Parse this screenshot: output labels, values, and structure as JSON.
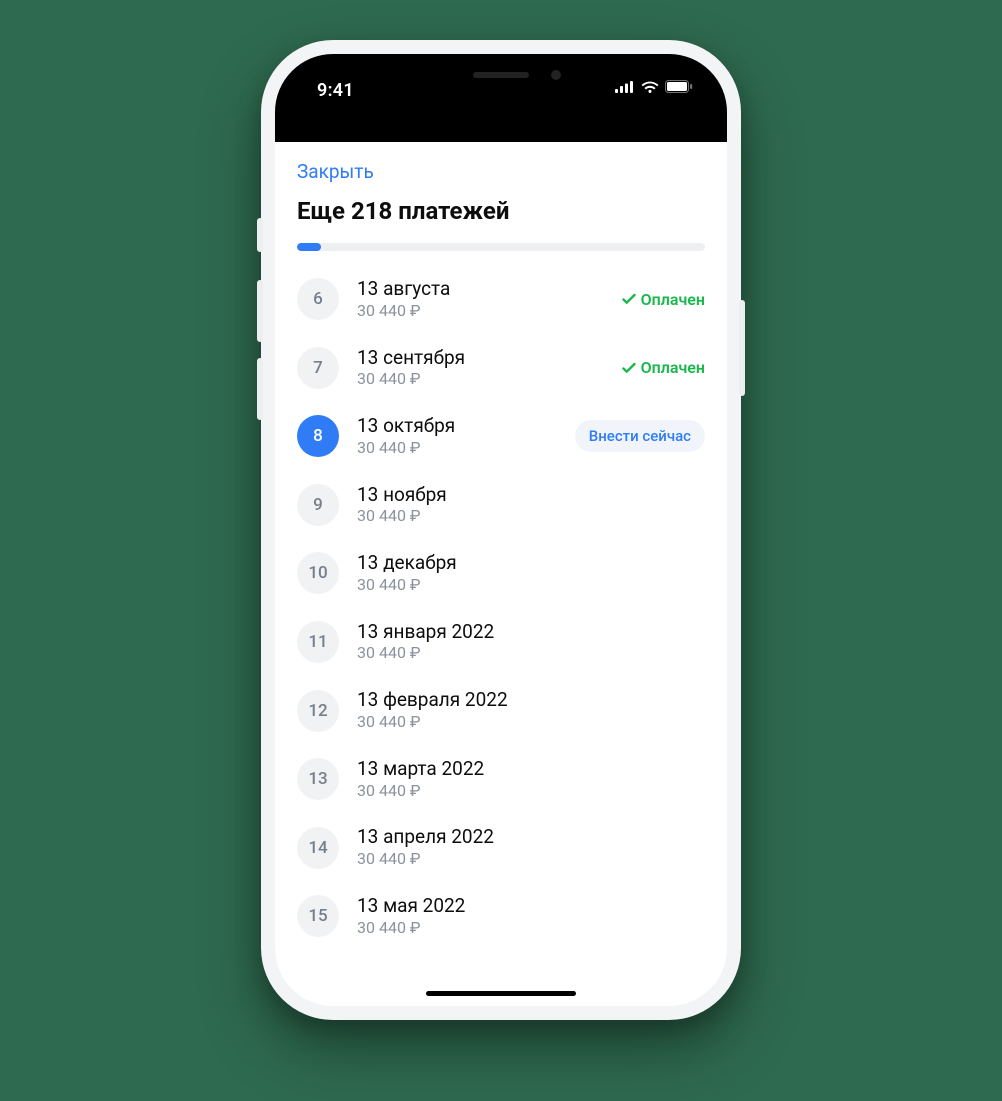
{
  "statusbar": {
    "time": "9:41"
  },
  "nav": {
    "close": "Закрыть"
  },
  "header": {
    "title": "Еще 218 платежей"
  },
  "progress": {
    "percent": 6
  },
  "labels": {
    "paid": "Оплачен",
    "pay_now": "Внести сейчас"
  },
  "payments": [
    {
      "n": "6",
      "date": "13 августа",
      "amount": "30 440 ₽",
      "status": "paid"
    },
    {
      "n": "7",
      "date": "13 сентября",
      "amount": "30 440 ₽",
      "status": "paid"
    },
    {
      "n": "8",
      "date": "13 октября",
      "amount": "30 440 ₽",
      "status": "due"
    },
    {
      "n": "9",
      "date": "13 ноября",
      "amount": "30 440 ₽",
      "status": "future"
    },
    {
      "n": "10",
      "date": "13 декабря",
      "amount": "30 440 ₽",
      "status": "future"
    },
    {
      "n": "11",
      "date": "13 января 2022",
      "amount": "30 440 ₽",
      "status": "future"
    },
    {
      "n": "12",
      "date": "13 февраля 2022",
      "amount": "30 440 ₽",
      "status": "future"
    },
    {
      "n": "13",
      "date": "13 марта 2022",
      "amount": "30 440 ₽",
      "status": "future"
    },
    {
      "n": "14",
      "date": "13 апреля 2022",
      "amount": "30 440 ₽",
      "status": "future"
    },
    {
      "n": "15",
      "date": "13 мая 2022",
      "amount": "30 440 ₽",
      "status": "future"
    }
  ]
}
